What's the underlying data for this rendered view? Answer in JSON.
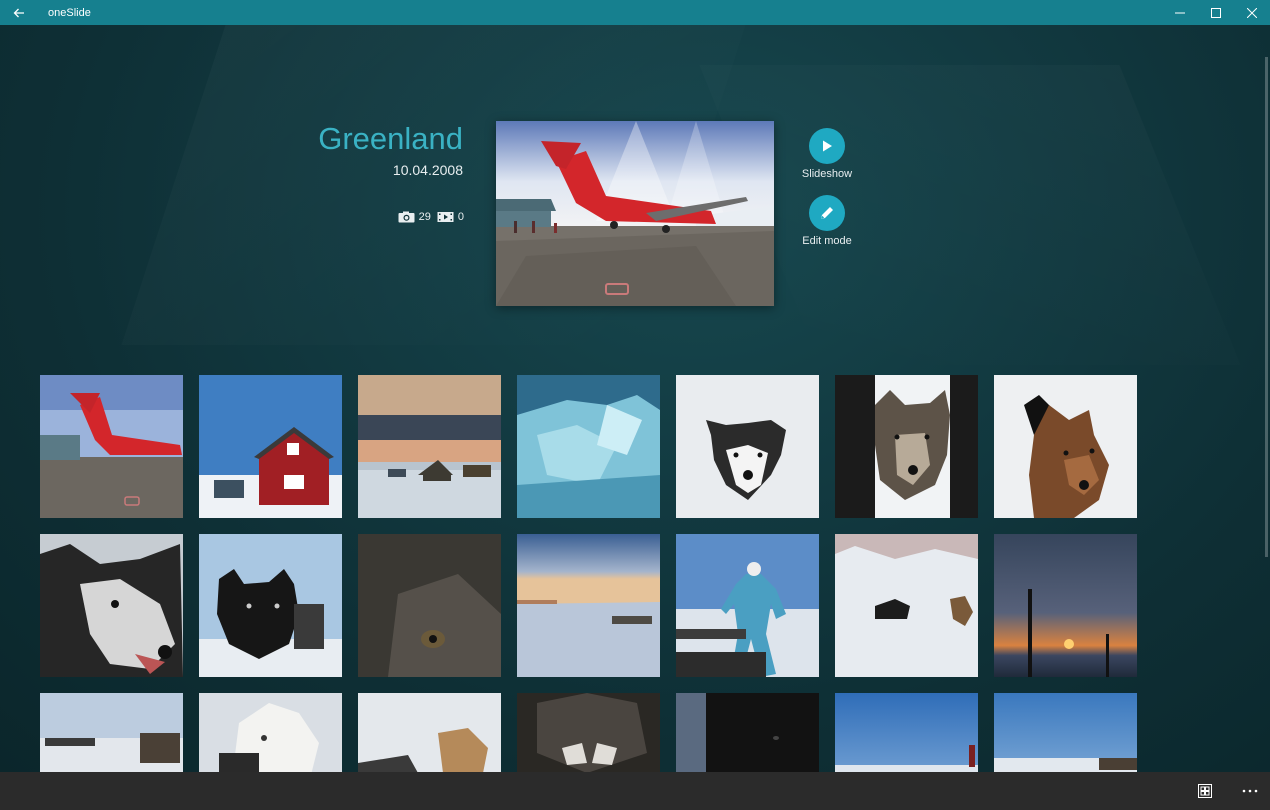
{
  "window": {
    "title": "oneSlide",
    "back_icon": "back-arrow-icon",
    "controls": [
      "minimize-icon",
      "maximize-icon",
      "close-icon"
    ]
  },
  "album": {
    "title": "Greenland",
    "date": "10.04.2008",
    "photo_count": "29",
    "video_count": "0"
  },
  "actions": {
    "slideshow_label": "Slideshow",
    "edit_label": "Edit mode"
  },
  "colors": {
    "titlebar": "#16808f",
    "accent": "#1fa9c2",
    "title_text": "#3ab2c4",
    "appbar": "#2b2b2b"
  },
  "photos": [
    {
      "scene": "red airplane on tarmac"
    },
    {
      "scene": "red wooden house under blue sky"
    },
    {
      "scene": "village at dusk"
    },
    {
      "scene": "blue ice blocks"
    },
    {
      "scene": "husky face in snow"
    },
    {
      "scene": "grey husky"
    },
    {
      "scene": "brown husky in snow"
    },
    {
      "scene": "husky close-up"
    },
    {
      "scene": "black husky puppy"
    },
    {
      "scene": "wolf-like dog eye close-up"
    },
    {
      "scene": "sled on sea ice at dusk"
    },
    {
      "scene": "man running with sled dogs"
    },
    {
      "scene": "dogs on snow with mountains"
    },
    {
      "scene": "sunset over ice with pole"
    },
    {
      "scene": "dog team on ice"
    },
    {
      "scene": "white husky"
    },
    {
      "scene": "sled dogs resting in snow"
    },
    {
      "scene": "dark husky close-up"
    },
    {
      "scene": "black dog in shadow"
    },
    {
      "scene": "person on ice under blue sky"
    },
    {
      "scene": "sled on ice horizon"
    }
  ],
  "appbar": {
    "view_icon": "select-grid-icon",
    "more_icon": "more-ellipsis-icon"
  }
}
